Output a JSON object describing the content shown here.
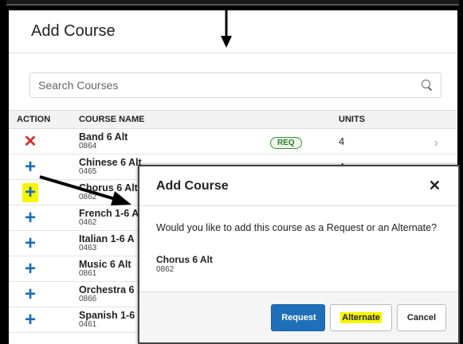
{
  "header": {
    "title": "Add Course"
  },
  "search": {
    "placeholder": "Search Courses"
  },
  "table": {
    "columns": {
      "action": "ACTION",
      "name": "COURSE NAME",
      "units": "UNITS"
    },
    "rows": [
      {
        "action": "remove",
        "name": "Band 6 Alt",
        "code": "0864",
        "badge": "REQ",
        "units": "4"
      },
      {
        "action": "add",
        "name": "Chinese 6 Alt",
        "code": "0465",
        "badge": "",
        "units": "4"
      },
      {
        "action": "add-highlighted",
        "name": "Chorus 6 Alt",
        "code": "0862",
        "badge": "",
        "units": ""
      },
      {
        "action": "add",
        "name": "French 1-6 A",
        "code": "0462",
        "badge": "",
        "units": ""
      },
      {
        "action": "add",
        "name": "Italian 1-6 A",
        "code": "0463",
        "badge": "",
        "units": ""
      },
      {
        "action": "add",
        "name": "Music 6 Alt",
        "code": "0861",
        "badge": "",
        "units": ""
      },
      {
        "action": "add",
        "name": "Orchestra 6",
        "code": "0866",
        "badge": "",
        "units": ""
      },
      {
        "action": "add",
        "name": "Spanish 1-6",
        "code": "0461",
        "badge": "",
        "units": ""
      }
    ]
  },
  "modal": {
    "title": "Add Course",
    "question": "Would you like to add this course as a Request or an Alternate?",
    "course_name": "Chorus 6 Alt",
    "course_code": "0862",
    "buttons": {
      "request": "Request",
      "alternate": "Alternate",
      "cancel": "Cancel"
    }
  },
  "icons": {
    "remove": "x-icon",
    "add": "plus-icon",
    "row_nav": "chevron-right-icon",
    "close": "close-icon",
    "search": "search-icon"
  },
  "colors": {
    "primary": "#1e6fb9",
    "remove": "#d82c2c",
    "add": "#1a6bb5",
    "highlight": "#f5f500",
    "req_badge": "#3e8e3e"
  }
}
